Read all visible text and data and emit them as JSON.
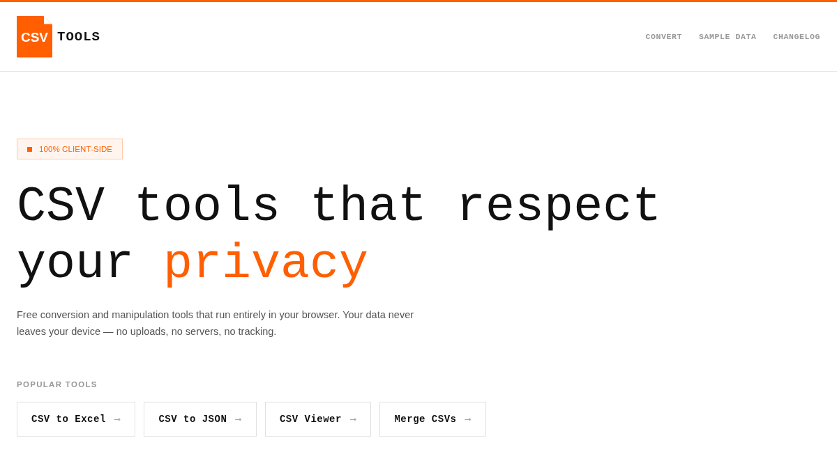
{
  "header": {
    "logo": {
      "mark": "CSV",
      "word": "TOOLS"
    },
    "nav": [
      "CONVERT",
      "SAMPLE DATA",
      "CHANGELOG"
    ]
  },
  "hero": {
    "badge": "100% CLIENT-SIDE",
    "headline": {
      "text": "CSV tools that respect your",
      "highlight": "privacy"
    },
    "description": "Free conversion and manipulation tools that run entirely in your browser. Your data never leaves your device — no uploads, no servers, no tracking."
  },
  "popular_tools": {
    "heading": "POPULAR TOOLS",
    "tools": [
      {
        "label": "CSV to Excel",
        "arrow": "→"
      },
      {
        "label": "CSV to JSON",
        "arrow": "→"
      },
      {
        "label": "CSV Viewer",
        "arrow": "→"
      },
      {
        "label": "Merge CSVs",
        "arrow": "→"
      }
    ]
  }
}
